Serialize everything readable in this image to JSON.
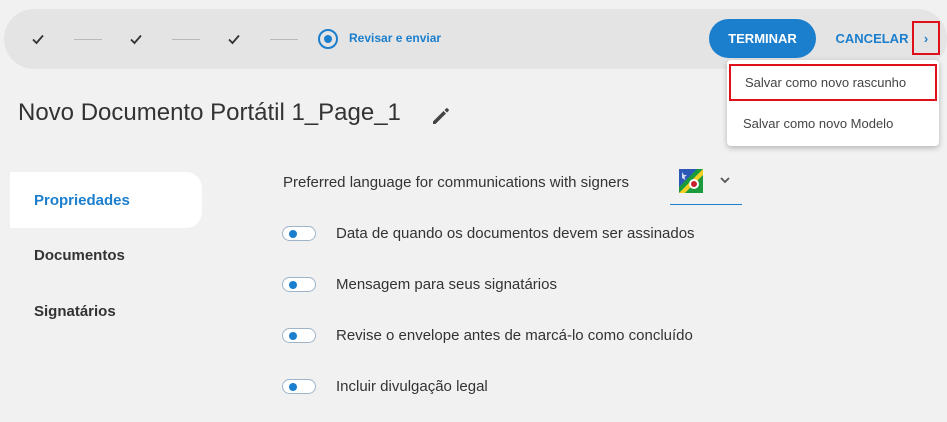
{
  "wizard": {
    "current_step_label": "Revisar e enviar",
    "finish_label": "TERMINAR",
    "cancel_label": "CANCELAR",
    "more_label": "›"
  },
  "dropdown": {
    "items": [
      {
        "label": "Salvar como novo rascunho"
      },
      {
        "label": "Salvar como novo Modelo"
      }
    ]
  },
  "document": {
    "title": "Novo Documento Portátil 1_Page_1"
  },
  "sidebar": {
    "items": [
      {
        "label": "Propriedades",
        "active": true
      },
      {
        "label": "Documentos",
        "active": false
      },
      {
        "label": "Signatários",
        "active": false
      }
    ]
  },
  "settings": {
    "language_label": "Preferred language for communications with signers",
    "options": [
      {
        "label": "Data de quando os documentos devem ser assinados",
        "enabled": true
      },
      {
        "label": "Mensagem para seus signatários",
        "enabled": true
      },
      {
        "label": "Revise o envelope antes de marcá-lo como concluído",
        "enabled": true
      },
      {
        "label": "Incluir divulgação legal",
        "enabled": true
      }
    ]
  },
  "colors": {
    "accent": "#1b7fce",
    "highlight": "#e0101a",
    "background": "#f1f1f1",
    "topbar": "#e4e4e4"
  },
  "icons": {
    "completed_step": "check-icon",
    "current_step": "radio-selected-icon",
    "edit": "pencil-icon",
    "language": "flag-icon",
    "select": "chevron-down-icon"
  }
}
